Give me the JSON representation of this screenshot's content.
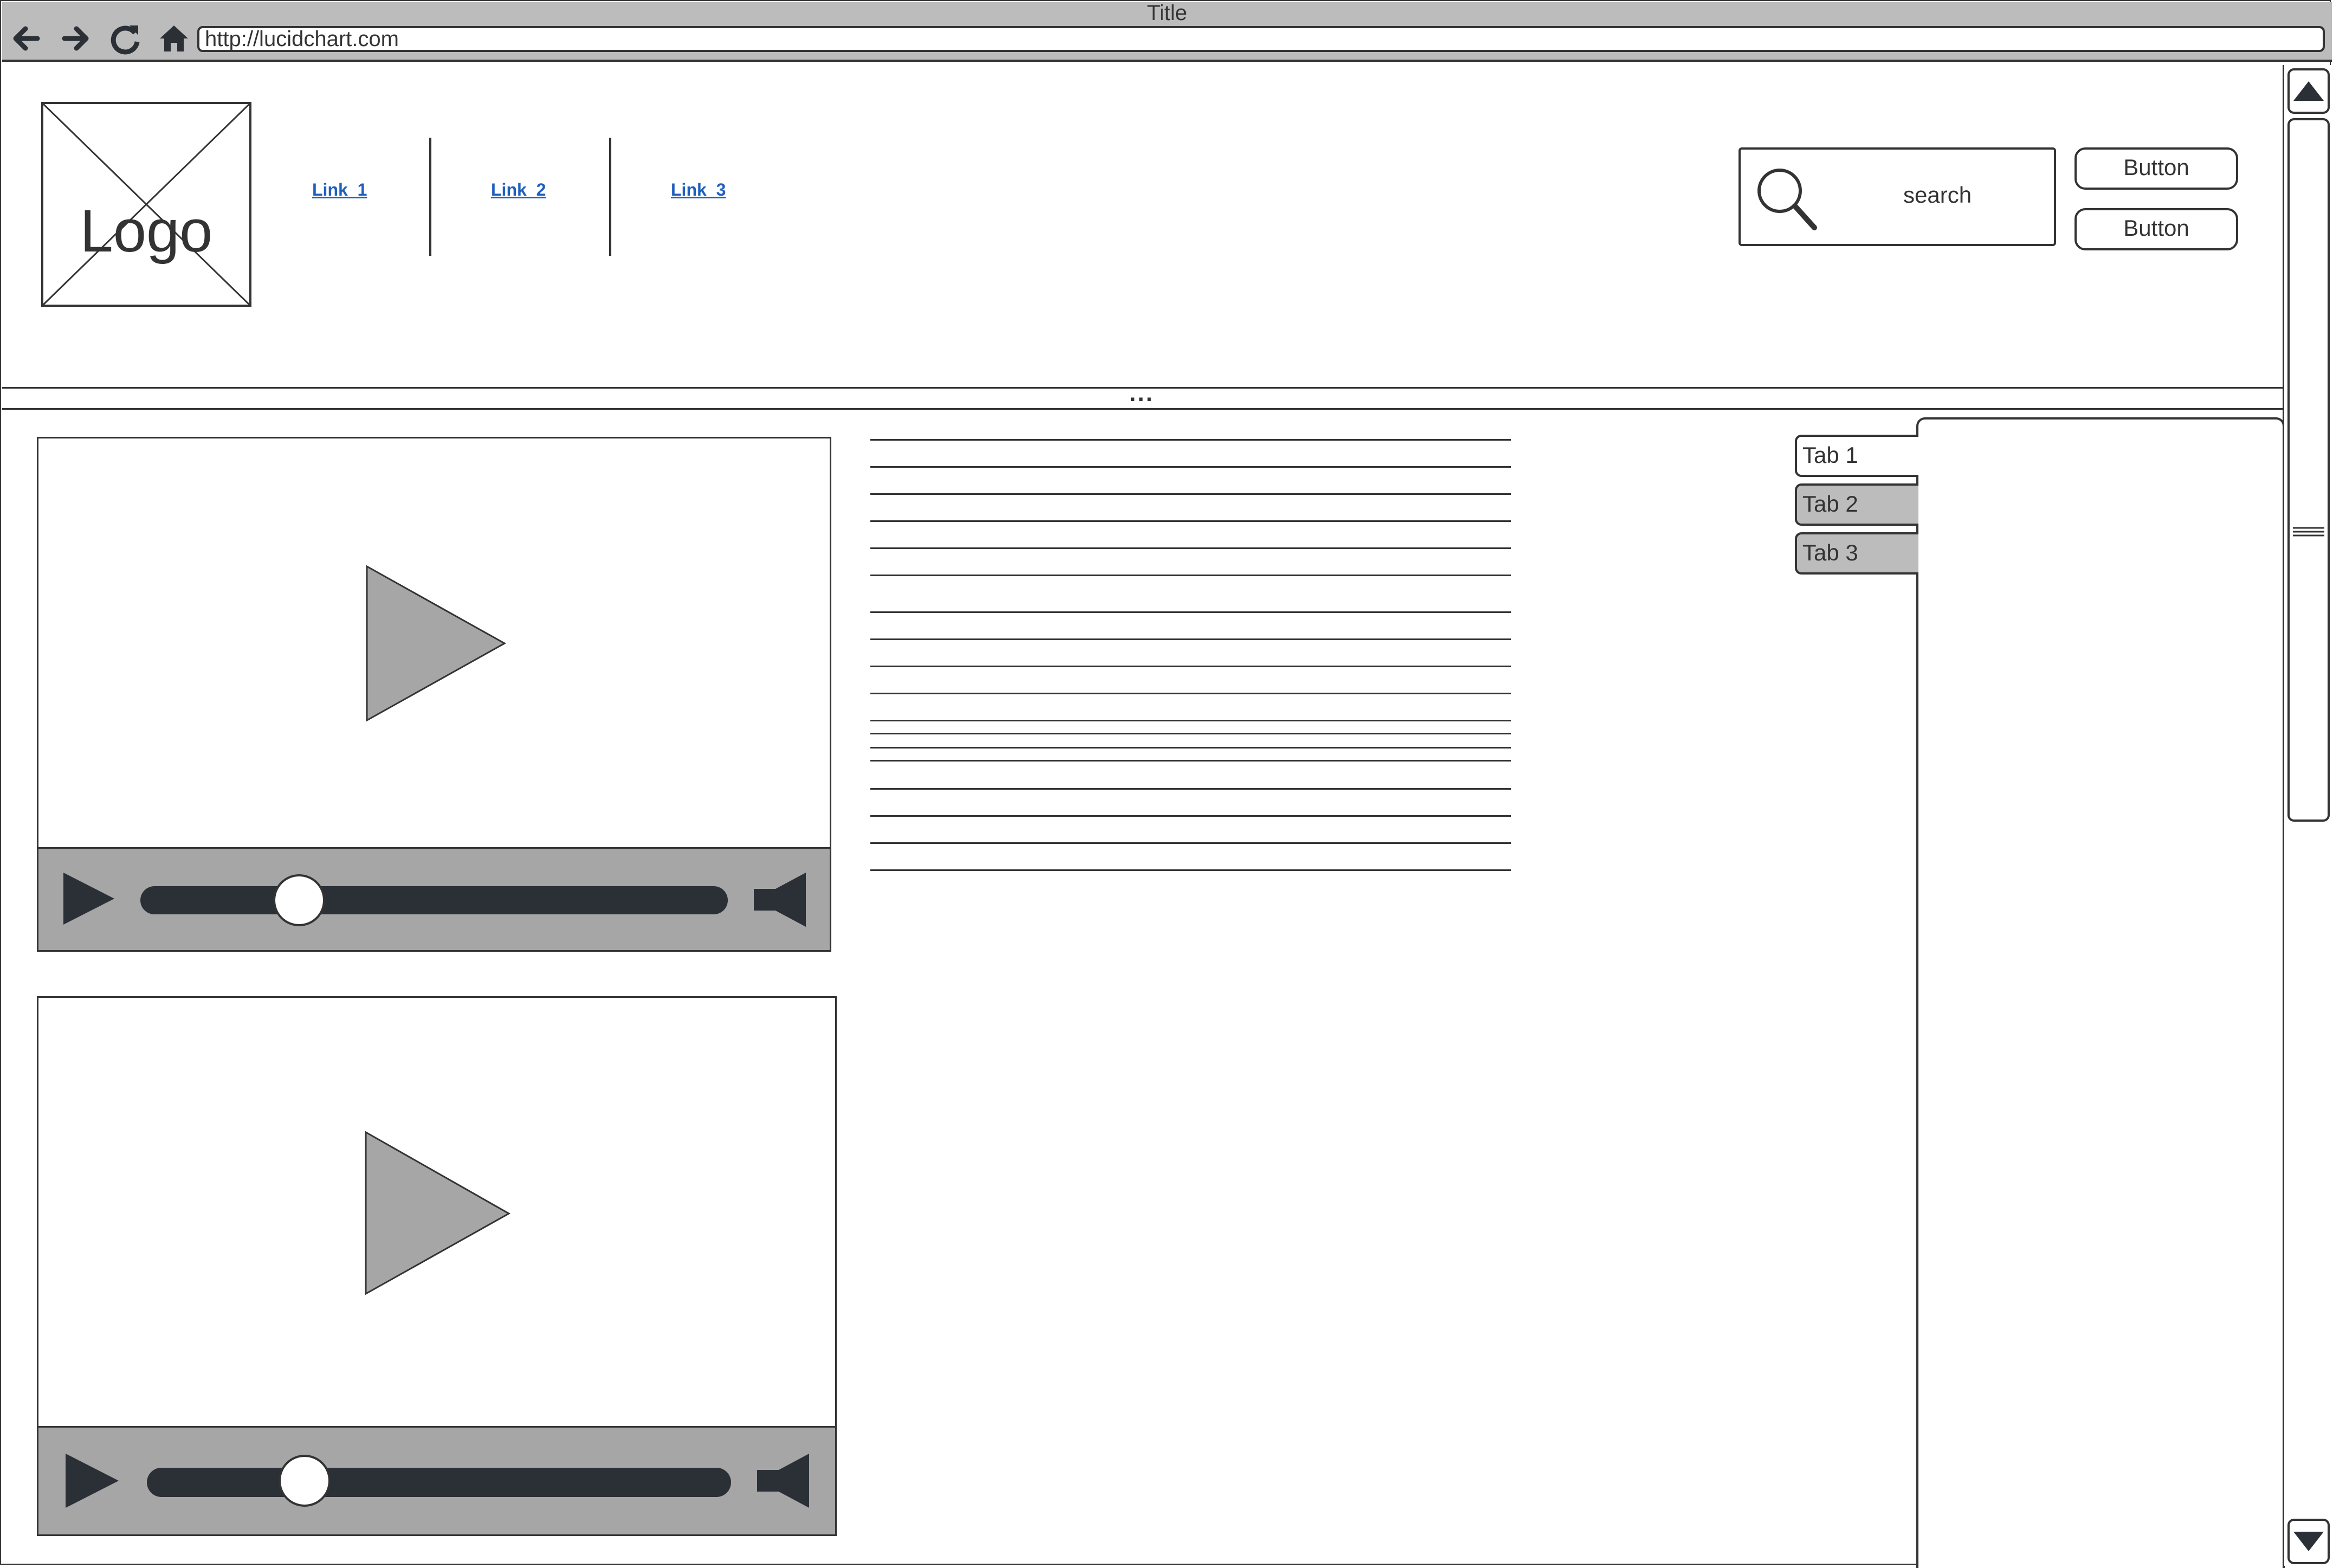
{
  "window": {
    "title": "Title",
    "url": "http://lucidchart.com"
  },
  "header": {
    "logo_label": "Logo",
    "links": [
      "Link_1",
      "Link_2",
      "Link_3"
    ],
    "search_placeholder": "search",
    "buttons": [
      "Button",
      "Button"
    ]
  },
  "divider": {
    "label": "..."
  },
  "videos": [
    {
      "progress": 0.27
    },
    {
      "progress": 0.27
    }
  ],
  "tabs": [
    {
      "label": "Tab 1",
      "active": true
    },
    {
      "label": "Tab 2",
      "active": false
    },
    {
      "label": "Tab 3",
      "active": false
    }
  ],
  "colors": {
    "stroke": "#333333",
    "control_bar": "#a6a6a6",
    "play_triangle": "#a6a6a6",
    "link": "#1f5fbf",
    "titlebar": "#bcbcbc"
  },
  "icons": {
    "nav": [
      "back-arrow-icon",
      "forward-arrow-icon",
      "refresh-icon",
      "home-icon"
    ],
    "search": "magnifier-icon",
    "video": [
      "play-icon",
      "volume-icon"
    ],
    "scroll": [
      "scroll-up-icon",
      "scroll-down-icon"
    ]
  }
}
